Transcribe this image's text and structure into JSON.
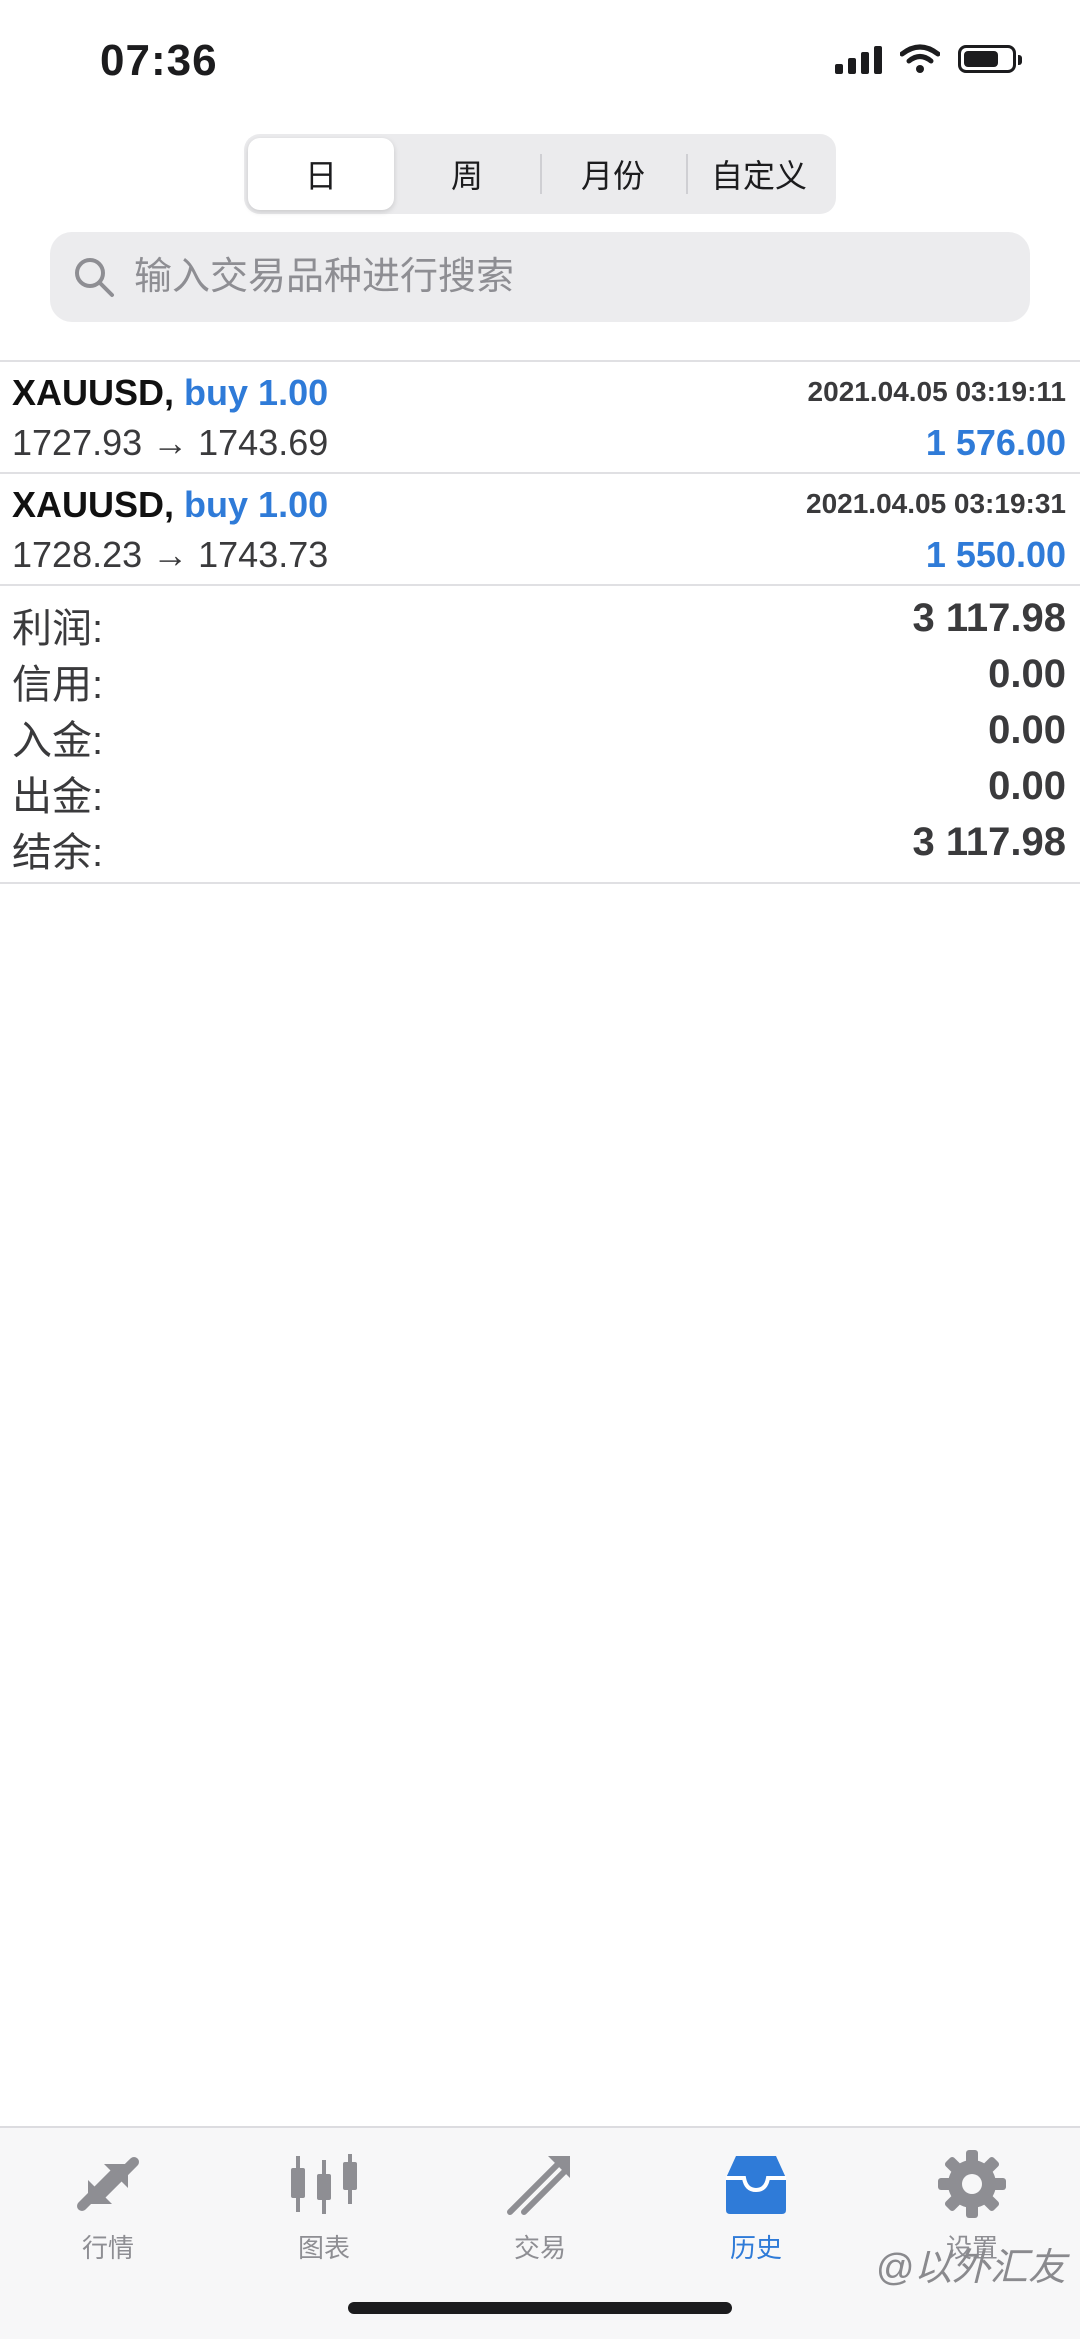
{
  "status_bar": {
    "time": "07:36"
  },
  "segmented": [
    "日",
    "周",
    "月份",
    "自定义"
  ],
  "search": {
    "placeholder": "输入交易品种进行搜索"
  },
  "trades": [
    {
      "symbol": "XAUUSD,",
      "type": "buy 1.00",
      "time": "2021.04.05 03:19:11",
      "prices": "1727.93 → 1743.69",
      "profit": "1 576.00"
    },
    {
      "symbol": "XAUUSD,",
      "type": "buy 1.00",
      "time": "2021.04.05 03:19:31",
      "prices": "1728.23 → 1743.73",
      "profit": "1 550.00"
    }
  ],
  "summary": [
    {
      "label": "利润:",
      "value": "3 117.98"
    },
    {
      "label": "信用:",
      "value": "0.00"
    },
    {
      "label": "入金:",
      "value": "0.00"
    },
    {
      "label": "出金:",
      "value": "0.00"
    },
    {
      "label": "结余:",
      "value": "3 117.98"
    }
  ],
  "tabbar": [
    {
      "label": "行情",
      "icon": "quotes-arrows-icon"
    },
    {
      "label": "图表",
      "icon": "candlestick-chart-icon"
    },
    {
      "label": "交易",
      "icon": "trade-trend-icon"
    },
    {
      "label": "历史",
      "icon": "history-inbox-icon",
      "active": true
    },
    {
      "label": "设置",
      "icon": "gear-icon"
    }
  ],
  "watermark": "@以外汇友",
  "colors": {
    "accent": "#2f7bd8",
    "inactive": "#8e8e93",
    "background": "#ffffff"
  }
}
